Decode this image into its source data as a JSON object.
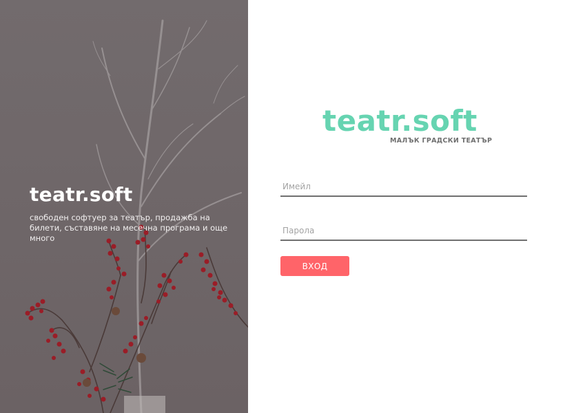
{
  "hero": {
    "title": "teatr.soft",
    "description": "свободен софтуер за театър, продажба на билети, съставяне на месечна програма и още много"
  },
  "brand": {
    "logo_text": "teatr.soft",
    "tagline": "МАЛЪК ГРАДСКИ ТЕАТЪР",
    "accent_color": "#66d4b1"
  },
  "login": {
    "email_placeholder": "Имейл",
    "password_placeholder": "Парола",
    "submit_label": "ВХОД",
    "button_color": "#ff6469"
  },
  "icons": [
    "branch-decor-icon"
  ]
}
